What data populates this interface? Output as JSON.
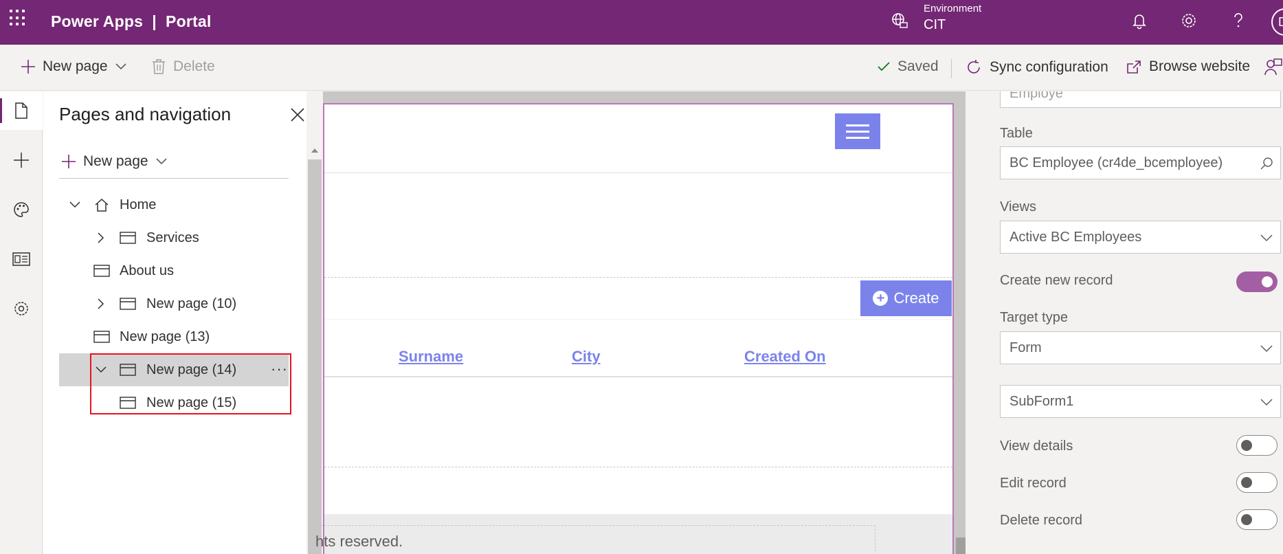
{
  "topbar": {
    "brand": "Power Apps  |  Portal",
    "environment_label": "Environment",
    "environment_value": "CIT",
    "avatar_initial": "D"
  },
  "commandbar": {
    "new_page": "New page",
    "delete": "Delete",
    "saved": "Saved",
    "sync": "Sync configuration",
    "browse": "Browse website"
  },
  "pages_panel": {
    "title": "Pages and navigation",
    "new_page": "New page",
    "items": [
      {
        "label": "Home",
        "expanded": true
      },
      {
        "label": "Services",
        "expanded": false
      },
      {
        "label": "About us"
      },
      {
        "label": "New page (10)",
        "expanded": false
      },
      {
        "label": "New page (13)"
      },
      {
        "label": "New page (14)",
        "expanded": true,
        "selected": true
      },
      {
        "label": "New page (15)"
      }
    ]
  },
  "canvas": {
    "create_label": "Create",
    "columns": [
      "Surname",
      "City",
      "Created On"
    ],
    "footer": "hts reserved."
  },
  "properties": {
    "name_value": "Employe",
    "table_label": "Table",
    "table_value": "BC Employee (cr4de_bcemployee)",
    "views_label": "Views",
    "views_value": "Active BC Employees",
    "create_new_record_label": "Create new record",
    "create_new_record_on": true,
    "target_type_label": "Target type",
    "target_type_value": "Form",
    "form_value": "SubForm1",
    "view_details_label": "View details",
    "view_details_on": false,
    "edit_record_label": "Edit record",
    "edit_record_on": false,
    "delete_record_label": "Delete record",
    "delete_record_on": false
  },
  "colors": {
    "brand": "#742774",
    "accent": "#7b83eb",
    "highlight": "#e81123"
  }
}
